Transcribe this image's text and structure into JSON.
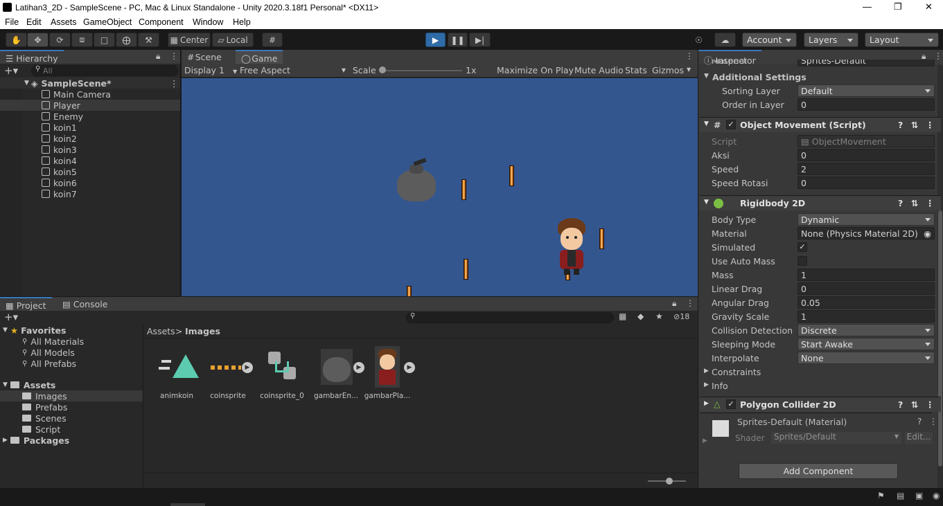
{
  "window": {
    "title": "Latihan3_2D - SampleScene - PC, Mac & Linux Standalone - Unity 2020.3.18f1 Personal* <DX11>"
  },
  "menu": [
    "File",
    "Edit",
    "Assets",
    "GameObject",
    "Component",
    "Window",
    "Help"
  ],
  "toolbar": {
    "pivot": "Center",
    "space": "Local",
    "account": "Account",
    "layers": "Layers",
    "layout": "Layout"
  },
  "hierarchy": {
    "tab": "Hierarchy",
    "search_placeholder": "All",
    "scene": "SampleScene*",
    "items": [
      "Main Camera",
      "Player",
      "Enemy",
      "koin1",
      "koin2",
      "koin3",
      "koin4",
      "koin5",
      "koin6",
      "koin7"
    ]
  },
  "game": {
    "tabs": [
      "Scene",
      "Game"
    ],
    "display": "Display 1",
    "aspect": "Free Aspect",
    "scale_label": "Scale",
    "scale_value": "1x",
    "buttons": [
      "Maximize On Play",
      "Mute Audio",
      "Stats",
      "Gizmos"
    ],
    "bg_color": "#34568f"
  },
  "project": {
    "tabs": [
      "Project",
      "Console"
    ],
    "hidden_count": "18",
    "favorites_label": "Favorites",
    "favorites": [
      "All Materials",
      "All Models",
      "All Prefabs"
    ],
    "assets_label": "Assets",
    "asset_folders": [
      "Images",
      "Prefabs",
      "Scenes",
      "Script"
    ],
    "packages_label": "Packages",
    "breadcrumb": [
      "Assets",
      "Images"
    ],
    "assets": [
      "animkoin",
      "coinsprite",
      "coinsprite_0",
      "gambarEn...",
      "gambarPla..."
    ]
  },
  "inspector": {
    "tab": "Inspector",
    "material_cut": "Material",
    "material_value": "Sprites-Default",
    "additional_settings": "Additional Settings",
    "sorting_layer_label": "Sorting Layer",
    "sorting_layer_value": "Default",
    "order_label": "Order in Layer",
    "order_value": "0",
    "om_title": "Object Movement (Script)",
    "om_script_label": "Script",
    "om_script_value": "ObjectMovement",
    "aksi_label": "Aksi",
    "aksi_value": "0",
    "speed_label": "Speed",
    "speed_value": "2",
    "speedrot_label": "Speed Rotasi",
    "speedrot_value": "0",
    "rb_title": "Rigidbody 2D",
    "body_type_label": "Body Type",
    "body_type_value": "Dynamic",
    "rb_material_label": "Material",
    "rb_material_value": "None (Physics Material 2D)",
    "simulated_label": "Simulated",
    "automass_label": "Use Auto Mass",
    "mass_label": "Mass",
    "mass_value": "1",
    "lindrag_label": "Linear Drag",
    "lindrag_value": "0",
    "angdrag_label": "Angular Drag",
    "angdrag_value": "0.05",
    "gravity_label": "Gravity Scale",
    "gravity_value": "1",
    "collision_label": "Collision Detection",
    "collision_value": "Discrete",
    "sleeping_label": "Sleeping Mode",
    "sleeping_value": "Start Awake",
    "interp_label": "Interpolate",
    "interp_value": "None",
    "constraints_label": "Constraints",
    "info_label": "Info",
    "pc_title": "Polygon Collider 2D",
    "mat_name": "Sprites-Default (Material)",
    "shader_label": "Shader",
    "shader_value": "Sprites/Default",
    "edit_label": "Edit...",
    "add_component": "Add Component"
  }
}
